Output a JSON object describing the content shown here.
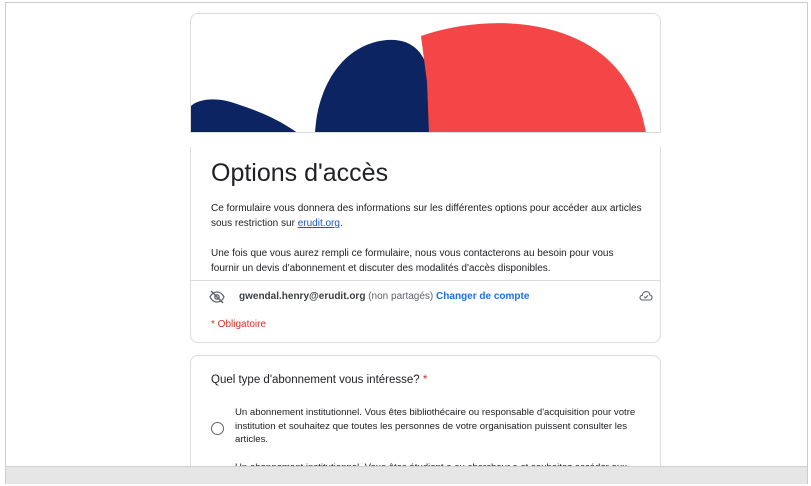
{
  "form": {
    "title": "Options d'accès",
    "description_p1_before": "Ce formulaire vous donnera des informations sur les différentes options pour accéder aux articles sous restriction sur ",
    "description_link": "erudit.org",
    "description_p1_after": ".",
    "description_p2": "Une fois que vous aurez rempli ce formulaire, nous vous contacterons au besoin pour vous fournir un devis d'abonnement et discuter des modalités d'accès disponibles.",
    "account_email": "gwendal.henry@erudit.org",
    "account_note": "(non partagés)",
    "switch_account": "Changer de compte",
    "required_note": "* Obligatoire"
  },
  "question": {
    "title": "Quel type d'abonnement vous intéresse?",
    "required_mark": "*",
    "options": [
      "Un abonnement institutionnel. Vous êtes bibliothécaire ou responsable d'acquisition pour votre institution et souhaitez que toutes les personnes de votre organisation puissent consulter les articles.",
      "Un abonnement institutionnel. Vous êtes étudiant.e ou chercheur.e et souhaitez accéder aux articles via la bibliothèque de votre établissement."
    ]
  },
  "icons": {
    "visibility": "eye-off-icon",
    "cloud": "cloud-check-icon"
  },
  "colors": {
    "navy": "#0c2461",
    "red": "#f44646",
    "link": "#1a73e8",
    "required": "#d93025"
  }
}
